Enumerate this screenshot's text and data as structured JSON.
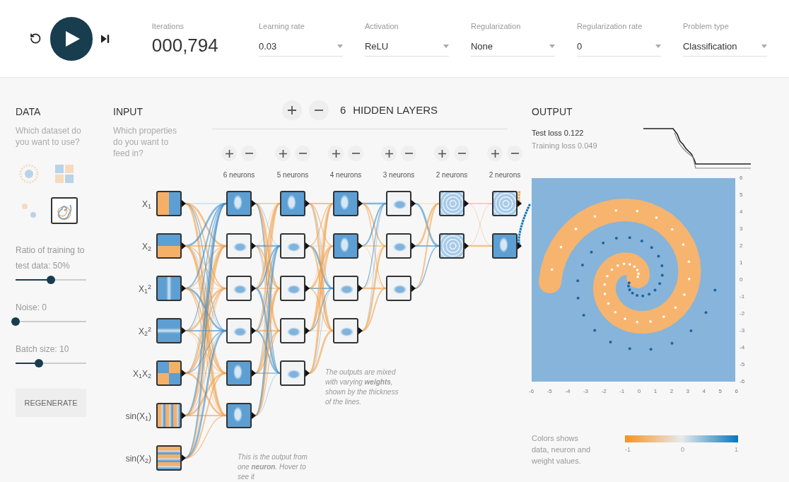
{
  "toolbar": {
    "playing": false,
    "iterations": {
      "label": "Iterations",
      "value": "000,794"
    },
    "dropdowns": [
      {
        "label": "Learning rate",
        "value": "0.03"
      },
      {
        "label": "Activation",
        "value": "ReLU"
      },
      {
        "label": "Regularization",
        "value": "None"
      },
      {
        "label": "Regularization rate",
        "value": "0"
      },
      {
        "label": "Problem type",
        "value": "Classification"
      }
    ]
  },
  "data": {
    "title": "DATA",
    "prompt": "Which dataset do you want to use?",
    "datasets": [
      {
        "kind": "circle",
        "selected": false
      },
      {
        "kind": "xor",
        "selected": false
      },
      {
        "kind": "gauss",
        "selected": false
      },
      {
        "kind": "spiral",
        "selected": true
      }
    ],
    "sliders": [
      {
        "label": "Ratio of training to test data:",
        "value": "50%",
        "level": 0.5
      },
      {
        "label": "Noise:",
        "value": "0",
        "level": 0
      },
      {
        "label": "Batch size:",
        "value": "10",
        "level": 0.33
      }
    ],
    "regenerate": "REGENERATE"
  },
  "input": {
    "title": "INPUT",
    "prompt": "Which properties do you want to feed in?",
    "features": [
      {
        "label": "X$_{1}$",
        "kind": "x1"
      },
      {
        "label": "X$_{2}$",
        "kind": "x2"
      },
      {
        "label": "X$_{1}$$^{2}$",
        "kind": "x1sq"
      },
      {
        "label": "X$_{2}$$^{2}$",
        "kind": "x2sq"
      },
      {
        "label": "X$_{1}$X$_{2}$",
        "kind": "x1x2"
      },
      {
        "label": "sin(X$_{1}$)",
        "kind": "sinx1"
      },
      {
        "label": "sin(X$_{2}$)",
        "kind": "sinx2"
      }
    ]
  },
  "hidden": {
    "count": "6",
    "title": "HIDDEN LAYERS",
    "layers": [
      {
        "label": "6 neurons",
        "neurons": [
          {
            "kind": "blue"
          },
          {
            "kind": "pale"
          },
          {
            "kind": "pale"
          },
          {
            "kind": "pale"
          },
          {
            "kind": "blue"
          },
          {
            "kind": "blue"
          }
        ]
      },
      {
        "label": "5 neurons",
        "neurons": [
          {
            "kind": "blue"
          },
          {
            "kind": "pale"
          },
          {
            "kind": "pale"
          },
          {
            "kind": "pale"
          },
          {
            "kind": "pale"
          }
        ]
      },
      {
        "label": "4 neurons",
        "neurons": [
          {
            "kind": "blue"
          },
          {
            "kind": "blue"
          },
          {
            "kind": "pale"
          },
          {
            "kind": "pale"
          }
        ]
      },
      {
        "label": "3 neurons",
        "neurons": [
          {
            "kind": "pale"
          },
          {
            "kind": "pale"
          },
          {
            "kind": "pale"
          }
        ]
      },
      {
        "label": "2 neurons",
        "neurons": [
          {
            "kind": "swirl"
          },
          {
            "kind": "swirl"
          }
        ]
      },
      {
        "label": "2 neurons",
        "neurons": [
          {
            "kind": "swirl"
          },
          {
            "kind": "blue"
          }
        ]
      }
    ]
  },
  "notes": [
    {
      "text": "The outputs are mixed with varying **weights**, shown by the thickness of the lines."
    },
    {
      "text": "This is the output from one **neuron**. Hover to see it"
    }
  ],
  "output": {
    "title": "OUTPUT",
    "test_loss": "Test loss 0.122",
    "training_loss": "Training loss 0.049",
    "yticks": [
      "6",
      "5",
      "4",
      "3",
      "2",
      "1",
      "0",
      "-1",
      "-2",
      "-3",
      "-4",
      "-5",
      "-6"
    ],
    "xticks": [
      "-6",
      "-5",
      "-4",
      "-3",
      "-2",
      "-1",
      "0",
      "1",
      "2",
      "3",
      "4",
      "5",
      "6"
    ],
    "legend": {
      "text": "Colors shows data, neuron and weight values.",
      "ticks": [
        "-1",
        "0",
        "1"
      ]
    }
  }
}
